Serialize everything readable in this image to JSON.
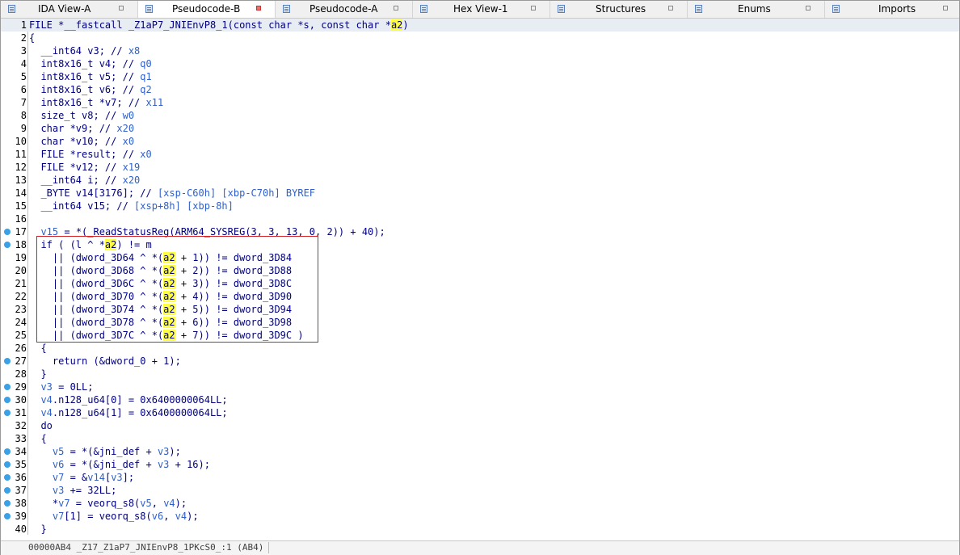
{
  "tabs": [
    {
      "label": "IDA View-A",
      "active": false,
      "close_red": false
    },
    {
      "label": "Pseudocode-B",
      "active": true,
      "close_red": true
    },
    {
      "label": "Pseudocode-A",
      "active": false,
      "close_red": false
    },
    {
      "label": "Hex View-1",
      "active": false,
      "close_red": false
    },
    {
      "label": "Structures",
      "active": false,
      "close_red": false
    },
    {
      "label": "Enums",
      "active": false,
      "close_red": false
    },
    {
      "label": "Imports",
      "active": false,
      "close_red": false
    }
  ],
  "code_lines": [
    {
      "n": "1",
      "dot": false,
      "parts": [
        [
          "t",
          "FILE *__fastcall _Z1aP7_JNIEnvP8_1(const char *s, const char *"
        ],
        [
          "h",
          "a2"
        ],
        [
          "t",
          ")"
        ]
      ]
    },
    {
      "n": "2",
      "dot": false,
      "parts": [
        [
          "t",
          "{"
        ]
      ]
    },
    {
      "n": "3",
      "dot": false,
      "parts": [
        [
          "t",
          "  __int64 v3; // "
        ],
        [
          "c",
          "x8"
        ]
      ]
    },
    {
      "n": "4",
      "dot": false,
      "parts": [
        [
          "t",
          "  int8x16_t v4; // "
        ],
        [
          "c",
          "q0"
        ]
      ]
    },
    {
      "n": "5",
      "dot": false,
      "parts": [
        [
          "t",
          "  int8x16_t v5; // "
        ],
        [
          "c",
          "q1"
        ]
      ]
    },
    {
      "n": "6",
      "dot": false,
      "parts": [
        [
          "t",
          "  int8x16_t v6; // "
        ],
        [
          "c",
          "q2"
        ]
      ]
    },
    {
      "n": "7",
      "dot": false,
      "parts": [
        [
          "t",
          "  int8x16_t *v7; // "
        ],
        [
          "c",
          "x11"
        ]
      ]
    },
    {
      "n": "8",
      "dot": false,
      "parts": [
        [
          "t",
          "  size_t v8; // "
        ],
        [
          "c",
          "w0"
        ]
      ]
    },
    {
      "n": "9",
      "dot": false,
      "parts": [
        [
          "t",
          "  char *v9; // "
        ],
        [
          "c",
          "x20"
        ]
      ]
    },
    {
      "n": "10",
      "dot": false,
      "parts": [
        [
          "t",
          "  char *v10; // "
        ],
        [
          "c",
          "x0"
        ]
      ]
    },
    {
      "n": "11",
      "dot": false,
      "parts": [
        [
          "t",
          "  FILE *result; // "
        ],
        [
          "c",
          "x0"
        ]
      ]
    },
    {
      "n": "12",
      "dot": false,
      "parts": [
        [
          "t",
          "  FILE *v12; // "
        ],
        [
          "c",
          "x19"
        ]
      ]
    },
    {
      "n": "13",
      "dot": false,
      "parts": [
        [
          "t",
          "  __int64 i; // "
        ],
        [
          "c",
          "x20"
        ]
      ]
    },
    {
      "n": "14",
      "dot": false,
      "parts": [
        [
          "t",
          "  _BYTE v14[3176]; // "
        ],
        [
          "c",
          "[xsp-C60h] [xbp-C70h] BYREF"
        ]
      ]
    },
    {
      "n": "15",
      "dot": false,
      "parts": [
        [
          "t",
          "  __int64 v15; // "
        ],
        [
          "c",
          "[xsp+8h] [xbp-8h]"
        ]
      ]
    },
    {
      "n": "16",
      "dot": false,
      "parts": [
        [
          "t",
          ""
        ]
      ]
    },
    {
      "n": "17",
      "dot": true,
      "parts": [
        [
          "t",
          "  "
        ],
        [
          "v",
          "v15"
        ],
        [
          "t",
          " = *(_ReadStatusReg(ARM64_SYSREG(3, 3, 13, 0, 2)) + 40);"
        ]
      ]
    },
    {
      "n": "18",
      "dot": true,
      "parts": [
        [
          "t",
          "  if ( (l ^ *"
        ],
        [
          "h",
          "a2"
        ],
        [
          "t",
          ") != m"
        ]
      ]
    },
    {
      "n": "19",
      "dot": false,
      "parts": [
        [
          "t",
          "    || (dword_3D64 ^ *("
        ],
        [
          "h",
          "a2"
        ],
        [
          "t",
          " + 1)) != dword_3D84"
        ]
      ]
    },
    {
      "n": "20",
      "dot": false,
      "parts": [
        [
          "t",
          "    || (dword_3D68 ^ *("
        ],
        [
          "h",
          "a2"
        ],
        [
          "t",
          " + 2)) != dword_3D88"
        ]
      ]
    },
    {
      "n": "21",
      "dot": false,
      "parts": [
        [
          "t",
          "    || (dword_3D6C ^ *("
        ],
        [
          "h",
          "a2"
        ],
        [
          "t",
          " + 3)) != dword_3D8C"
        ]
      ]
    },
    {
      "n": "22",
      "dot": false,
      "parts": [
        [
          "t",
          "    || (dword_3D70 ^ *("
        ],
        [
          "h",
          "a2"
        ],
        [
          "t",
          " + 4)) != dword_3D90"
        ]
      ]
    },
    {
      "n": "23",
      "dot": false,
      "parts": [
        [
          "t",
          "    || (dword_3D74 ^ *("
        ],
        [
          "h",
          "a2"
        ],
        [
          "t",
          " + 5)) != dword_3D94"
        ]
      ]
    },
    {
      "n": "24",
      "dot": false,
      "parts": [
        [
          "t",
          "    || (dword_3D78 ^ *("
        ],
        [
          "h",
          "a2"
        ],
        [
          "t",
          " + 6)) != dword_3D98"
        ]
      ]
    },
    {
      "n": "25",
      "dot": false,
      "parts": [
        [
          "t",
          "    || (dword_3D7C ^ *("
        ],
        [
          "h",
          "a2"
        ],
        [
          "t",
          " + 7)) != dword_3D9C )"
        ]
      ]
    },
    {
      "n": "26",
      "dot": false,
      "parts": [
        [
          "t",
          "  {"
        ]
      ]
    },
    {
      "n": "27",
      "dot": true,
      "parts": [
        [
          "t",
          "    return (&dword_0 + 1);"
        ]
      ]
    },
    {
      "n": "28",
      "dot": false,
      "parts": [
        [
          "t",
          "  }"
        ]
      ]
    },
    {
      "n": "29",
      "dot": true,
      "parts": [
        [
          "t",
          "  "
        ],
        [
          "v",
          "v3"
        ],
        [
          "t",
          " = 0LL;"
        ]
      ]
    },
    {
      "n": "30",
      "dot": true,
      "parts": [
        [
          "t",
          "  "
        ],
        [
          "v",
          "v4"
        ],
        [
          "t",
          ".n128_u64[0] = 0x6400000064LL;"
        ]
      ]
    },
    {
      "n": "31",
      "dot": true,
      "parts": [
        [
          "t",
          "  "
        ],
        [
          "v",
          "v4"
        ],
        [
          "t",
          ".n128_u64[1] = 0x6400000064LL;"
        ]
      ]
    },
    {
      "n": "32",
      "dot": false,
      "parts": [
        [
          "t",
          "  do"
        ]
      ]
    },
    {
      "n": "33",
      "dot": false,
      "parts": [
        [
          "t",
          "  {"
        ]
      ]
    },
    {
      "n": "34",
      "dot": true,
      "parts": [
        [
          "t",
          "    "
        ],
        [
          "v",
          "v5"
        ],
        [
          "t",
          " = *(&jni_def + "
        ],
        [
          "v",
          "v3"
        ],
        [
          "t",
          ");"
        ]
      ]
    },
    {
      "n": "35",
      "dot": true,
      "parts": [
        [
          "t",
          "    "
        ],
        [
          "v",
          "v6"
        ],
        [
          "t",
          " = *(&jni_def + "
        ],
        [
          "v",
          "v3"
        ],
        [
          "t",
          " + 16);"
        ]
      ]
    },
    {
      "n": "36",
      "dot": true,
      "parts": [
        [
          "t",
          "    "
        ],
        [
          "v",
          "v7"
        ],
        [
          "t",
          " = &"
        ],
        [
          "v",
          "v14"
        ],
        [
          "t",
          "["
        ],
        [
          "v",
          "v3"
        ],
        [
          "t",
          "];"
        ]
      ]
    },
    {
      "n": "37",
      "dot": true,
      "parts": [
        [
          "t",
          "    "
        ],
        [
          "v",
          "v3"
        ],
        [
          "t",
          " += 32LL;"
        ]
      ]
    },
    {
      "n": "38",
      "dot": true,
      "parts": [
        [
          "t",
          "    *"
        ],
        [
          "v",
          "v7"
        ],
        [
          "t",
          " = veorq_s8("
        ],
        [
          "v",
          "v5"
        ],
        [
          "t",
          ", "
        ],
        [
          "v",
          "v4"
        ],
        [
          "t",
          ");"
        ]
      ]
    },
    {
      "n": "39",
      "dot": true,
      "parts": [
        [
          "t",
          "    "
        ],
        [
          "v",
          "v7"
        ],
        [
          "t",
          "[1] = veorq_s8("
        ],
        [
          "v",
          "v6"
        ],
        [
          "t",
          ", "
        ],
        [
          "v",
          "v4"
        ],
        [
          "t",
          ");"
        ]
      ]
    },
    {
      "n": "40",
      "dot": false,
      "parts": [
        [
          "t",
          "  }"
        ]
      ]
    }
  ],
  "status_bar": {
    "address": "00000AB4 _Z17_Z1aP7_JNIEnvP8_1PKcS0_:1 (AB4)"
  }
}
